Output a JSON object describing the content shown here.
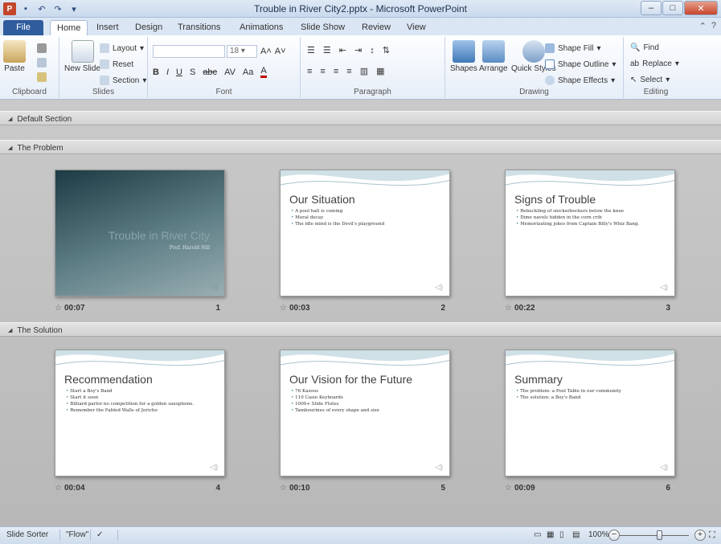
{
  "window": {
    "title": "Trouble in River City2.pptx - Microsoft PowerPoint",
    "app_icon": "P",
    "controls": [
      "minimize-icon",
      "maximize-icon",
      "close-icon"
    ]
  },
  "qat": [
    "save-icon",
    "undo-icon",
    "redo-icon",
    "customize-qat-icon"
  ],
  "tabs": [
    {
      "label": "File"
    },
    {
      "label": "Home"
    },
    {
      "label": "Insert"
    },
    {
      "label": "Design"
    },
    {
      "label": "Transitions"
    },
    {
      "label": "Animations"
    },
    {
      "label": "Slide Show"
    },
    {
      "label": "Review"
    },
    {
      "label": "View"
    }
  ],
  "ribbon": {
    "clipboard": {
      "label": "Clipboard",
      "paste": "Paste"
    },
    "slides": {
      "label": "Slides",
      "new_slide": "New Slide",
      "layout": "Layout",
      "reset": "Reset",
      "section": "Section"
    },
    "font": {
      "label": "Font",
      "size": "18"
    },
    "paragraph": {
      "label": "Paragraph"
    },
    "drawing": {
      "label": "Drawing",
      "shapes": "Shapes",
      "arrange": "Arrange",
      "quick_styles": "Quick Styles",
      "shape_fill": "Shape Fill",
      "shape_outline": "Shape Outline",
      "shape_effects": "Shape Effects"
    },
    "editing": {
      "label": "Editing",
      "find": "Find",
      "replace": "Replace",
      "select": "Select"
    }
  },
  "sections": [
    {
      "name": "Default Section"
    },
    {
      "name": "The Problem"
    },
    {
      "name": "The Solution"
    }
  ],
  "slides": [
    {
      "number": "1",
      "time": "00:07",
      "title": "Trouble in River City",
      "subtitle": "Prof. Harold Hill",
      "bullets": []
    },
    {
      "number": "2",
      "time": "00:03",
      "title": "Our Situation",
      "bullets": [
        "A pool hall is coming",
        "Moral decay",
        "The idle mind is the Devil's playground"
      ]
    },
    {
      "number": "3",
      "time": "00:22",
      "title": "Signs of Trouble",
      "bullets": [
        "Rebuckling of snickerbockers below the knee",
        "Dime navels hidden in the corn crib",
        "Memorizating jokes from Captain Billy's Whiz Bang."
      ]
    },
    {
      "number": "4",
      "time": "00:04",
      "title": "Recommendation",
      "bullets": [
        "Start a Boy's Band",
        "Start it soon",
        "Billiard parlor no competition for a golden saxophone.",
        "Remember the Fabled Walls of Jericho"
      ]
    },
    {
      "number": "5",
      "time": "00:10",
      "title": "Our Vision for the Future",
      "bullets": [
        "76 Kazoos",
        "110 Casio Keyboards",
        "1000+ Slide Flutes",
        "Tambourines of every shape and size"
      ]
    },
    {
      "number": "6",
      "time": "00:09",
      "title": "Summary",
      "bullets": [
        "The problem: a Pool Table in our community",
        "The solution: a Boy's Band"
      ]
    }
  ],
  "statusbar": {
    "view": "Slide Sorter",
    "theme": "\"Flow\"",
    "zoom": "100%"
  }
}
